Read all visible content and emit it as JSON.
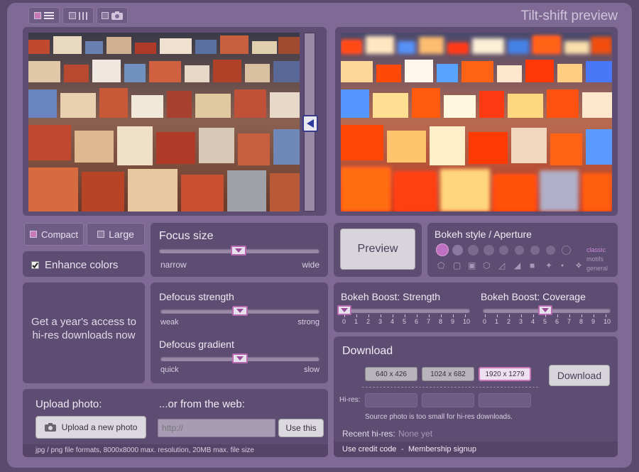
{
  "app": {
    "title": "Tilt-shift preview"
  },
  "mode_tabs": [
    {
      "icon": "list-icon"
    },
    {
      "icon": "columns-icon"
    },
    {
      "icon": "camera-icon"
    }
  ],
  "layout": {
    "compact_label": "Compact",
    "large_label": "Large"
  },
  "enhance": {
    "label": "Enhance colors",
    "checked": true
  },
  "focus_size": {
    "title": "Focus size",
    "min_label": "narrow",
    "max_label": "wide",
    "value": 0.5
  },
  "preview": {
    "button_label": "Preview"
  },
  "bokeh": {
    "title": "Bokeh style / Aperture",
    "categories": [
      "classic",
      "motifs",
      "general"
    ]
  },
  "promo": {
    "text": "Get a year's access to hi-res downloads now"
  },
  "defocus_strength": {
    "title": "Defocus strength",
    "min_label": "weak",
    "max_label": "strong",
    "value": 0.5
  },
  "defocus_gradient": {
    "title": "Defocus gradient",
    "min_label": "quick",
    "max_label": "slow",
    "value": 0.5
  },
  "bokeh_boost_strength": {
    "title": "Bokeh Boost: Strength",
    "ticks": [
      "0",
      "1",
      "2",
      "3",
      "4",
      "5",
      "6",
      "7",
      "8",
      "9",
      "10"
    ],
    "value": 0
  },
  "bokeh_boost_coverage": {
    "title": "Bokeh Boost: Coverage",
    "ticks": [
      "0",
      "1",
      "2",
      "3",
      "4",
      "5",
      "6",
      "7",
      "8",
      "9",
      "10"
    ],
    "value": 5
  },
  "download": {
    "title": "Download",
    "sizes": [
      "640 x 426",
      "1024 x 682",
      "1920 x 1279"
    ],
    "selected": 2,
    "button_label": "Download",
    "hires_label": "Hi-res:",
    "note": "Source photo is too small for hi-res downloads.",
    "recent_label": "Recent hi-res:",
    "recent_value": "None yet",
    "credit_link": "Use credit code",
    "separator": "-",
    "membership_link": "Membership signup"
  },
  "upload": {
    "title": "Upload photo:",
    "button_label": "Upload a new photo",
    "web_title": "...or from the web:",
    "url_placeholder": "http://",
    "use_label": "Use this",
    "formats": "jpg / png file formats, 8000x8000 max. resolution, 20MB max. file size"
  },
  "colors": {
    "frame": "#7e6a94",
    "panel": "#5e4d72",
    "accent": "#c87ab8"
  }
}
